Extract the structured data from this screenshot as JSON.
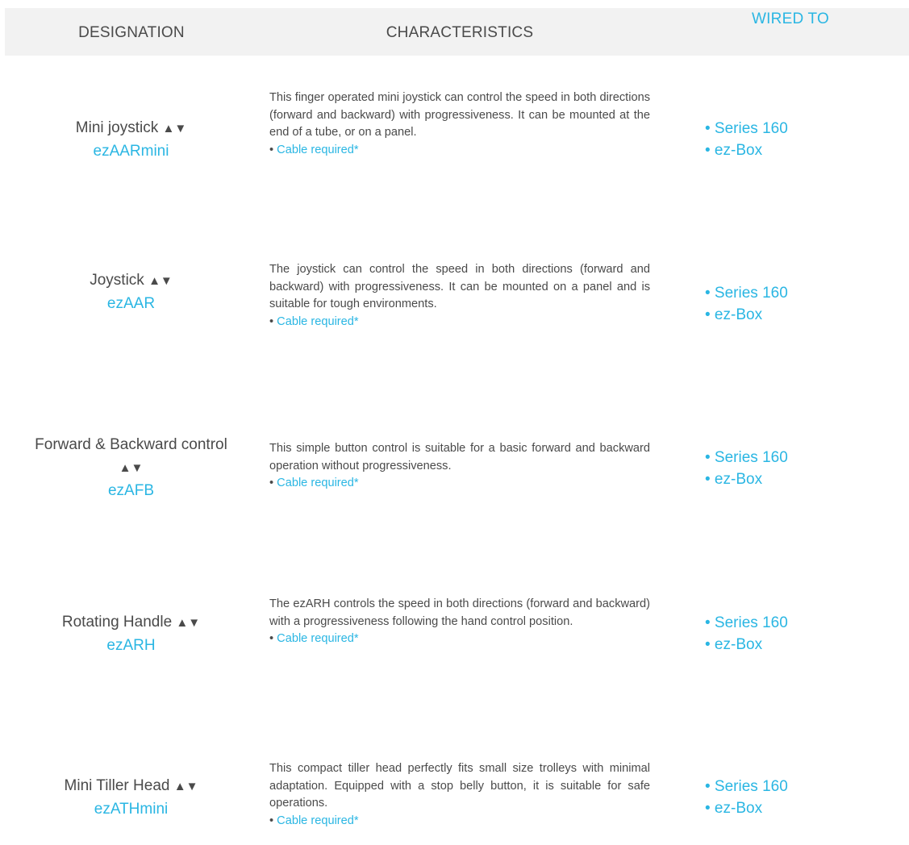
{
  "header": {
    "designation": "DESIGNATION",
    "characteristics": "CHARACTERISTICS",
    "wired_to": "WIRED TO"
  },
  "rows": [
    {
      "name": "Mini joystick",
      "arrows": "▲▼",
      "code": "ezAARmini",
      "description": "This finger operated mini joystick can control the speed in both directions (forward and backward) with progressiveness. It can be mounted at the end of a tube, or on a panel.",
      "cable": "Cable required*",
      "wired": [
        "• Series 160",
        "• ez-Box"
      ]
    },
    {
      "name": "Joystick",
      "arrows": "▲▼",
      "code": "ezAAR",
      "description": "The joystick can control the speed in both directions (forward and backward) with progressiveness. It can be mounted on a panel and is suitable for tough environments.",
      "cable": "Cable required*",
      "wired": [
        "• Series 160",
        "• ez-Box"
      ]
    },
    {
      "name": "Forward & Backward control",
      "arrows": "▲▼",
      "code": "ezAFB",
      "description": "This simple button control is suitable for a basic forward and backward operation without progressiveness.",
      "cable": "Cable required*",
      "wired": [
        "• Series 160",
        "• ez-Box"
      ]
    },
    {
      "name": "Rotating Handle",
      "arrows": "▲▼",
      "code": "ezARH",
      "description": "The ezARH controls the speed in both directions (forward and backward) with a progressiveness following the hand control position.",
      "cable": "Cable required*",
      "wired": [
        "• Series 160",
        "• ez-Box"
      ]
    },
    {
      "name": "Mini Tiller Head",
      "arrows": "▲▼",
      "code": "ezATHmini",
      "description": "This compact tiller head perfectly fits small size trolleys with minimal adaptation. Equipped with a stop belly button, it is suitable for safe operations.",
      "cable": "Cable required*",
      "wired": [
        "• Series 160",
        "• ez-Box"
      ]
    }
  ]
}
